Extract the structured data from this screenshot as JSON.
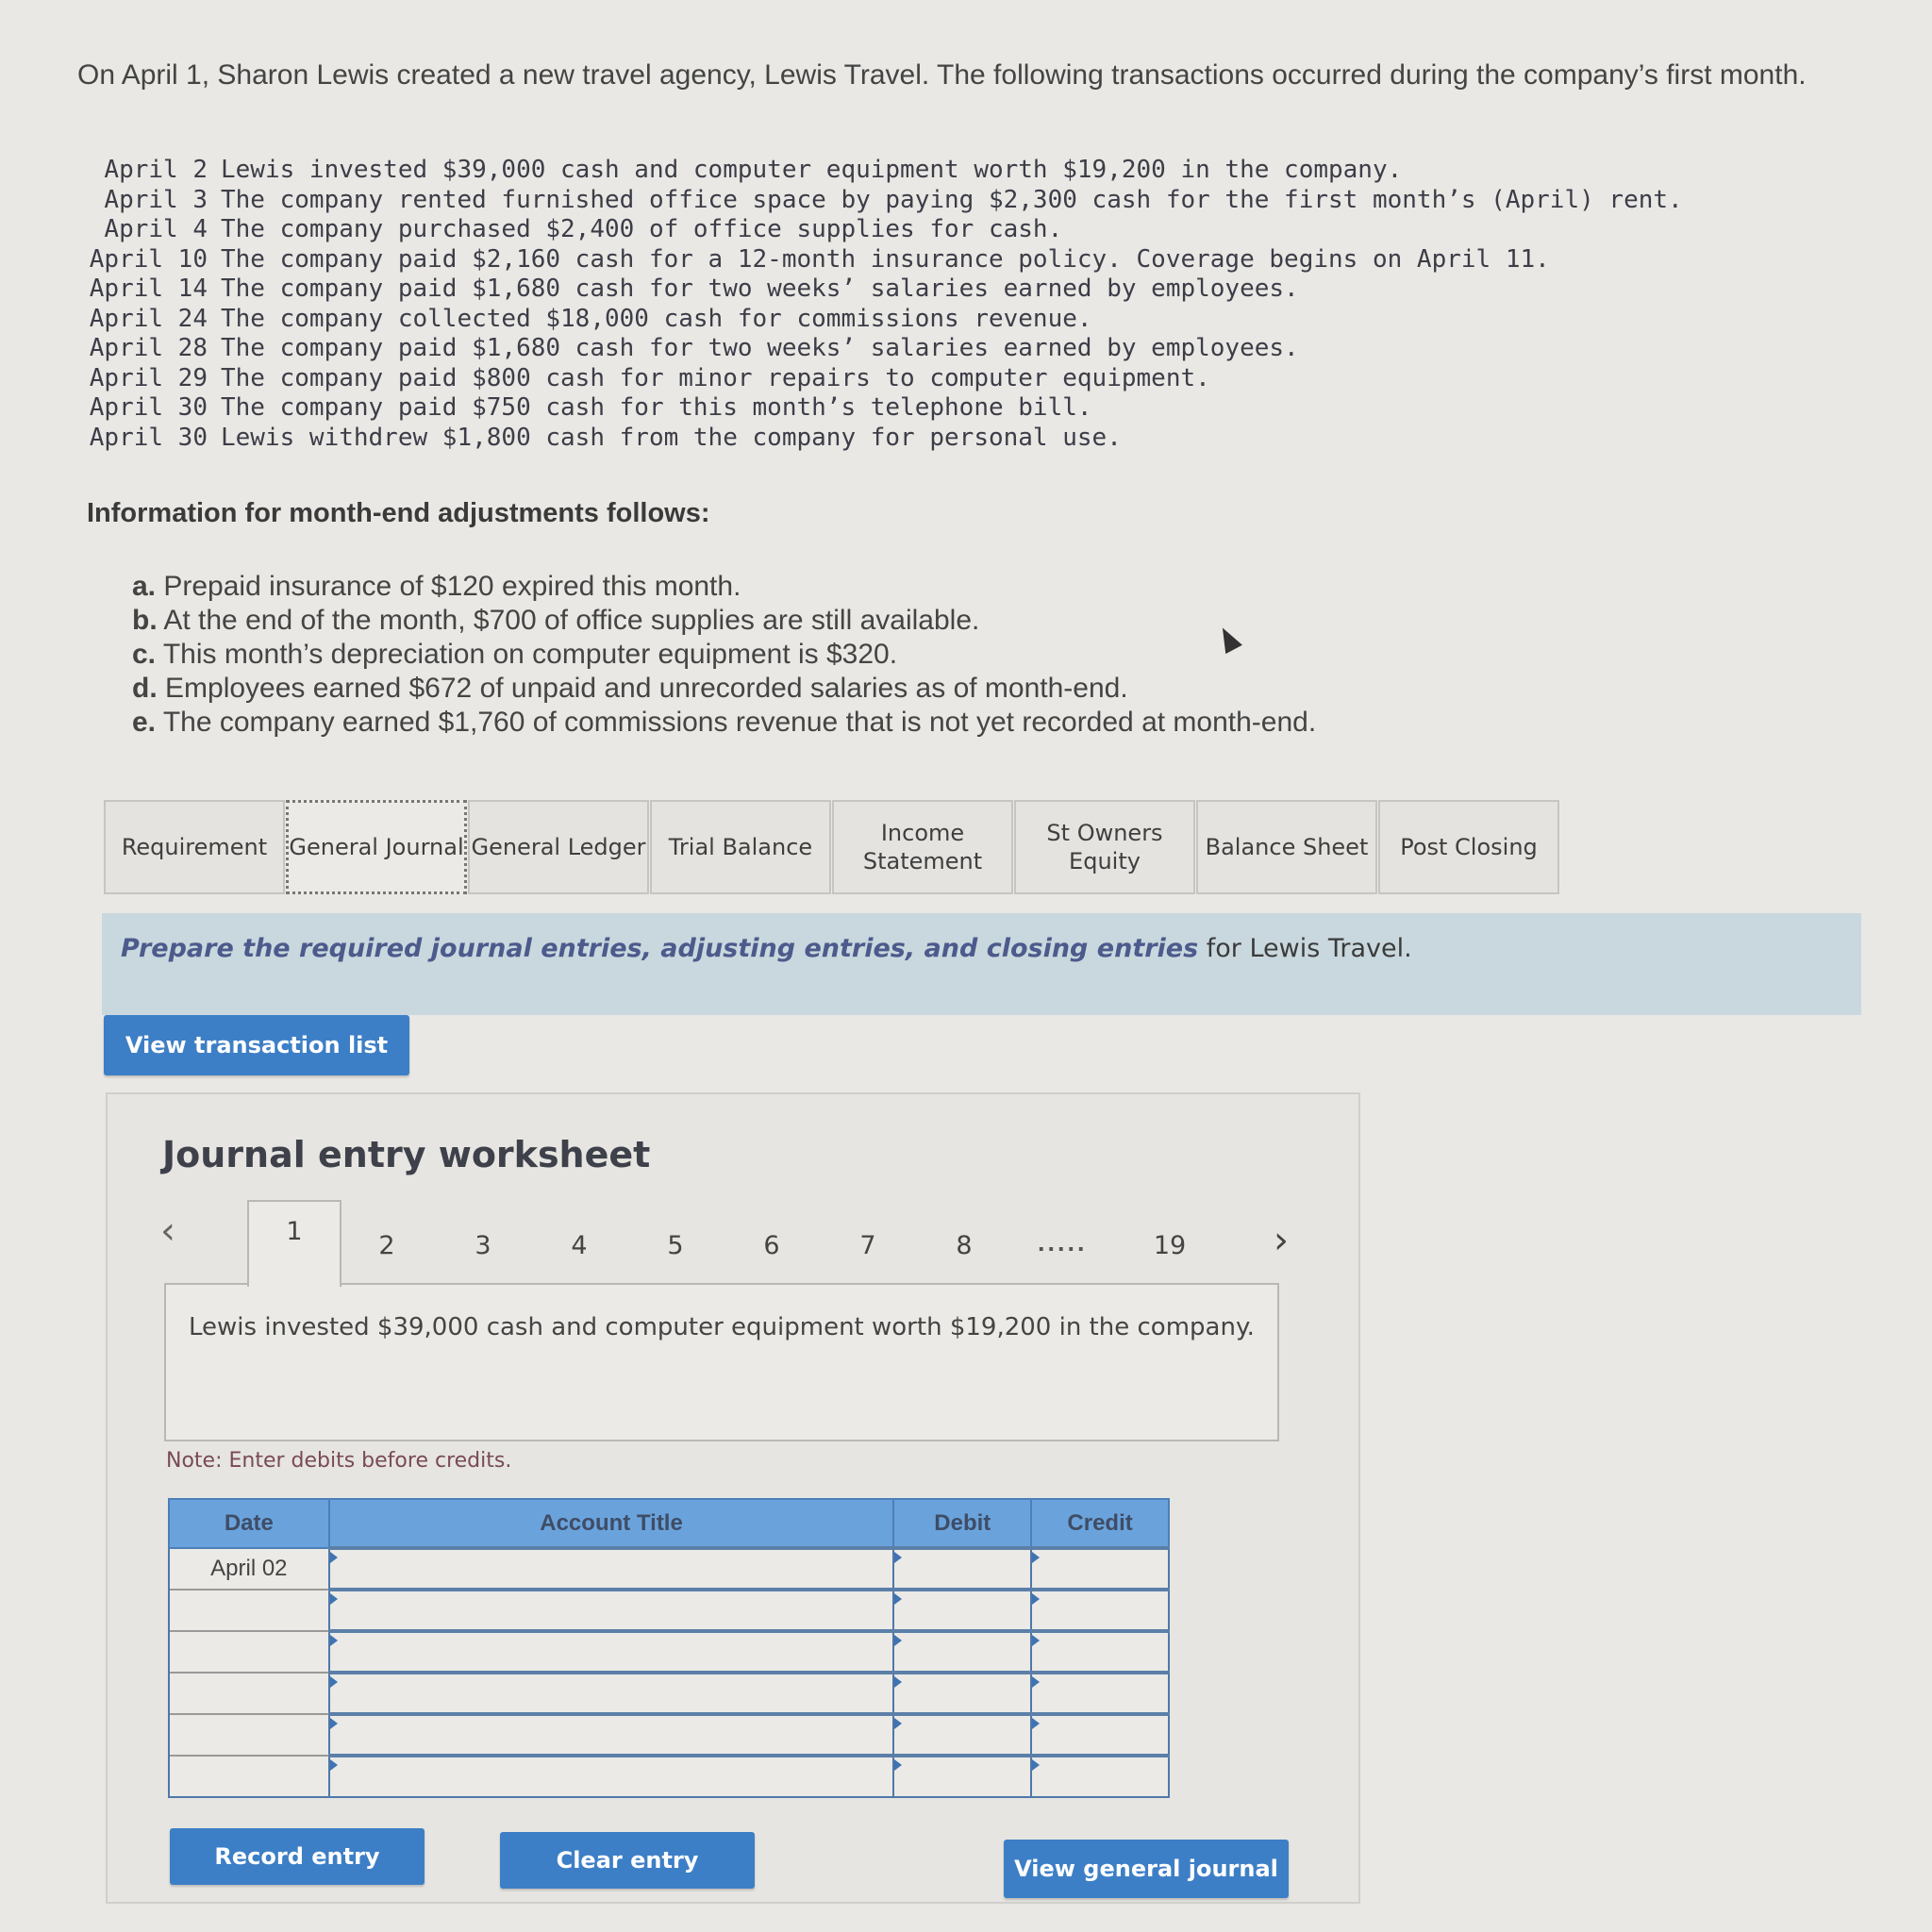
{
  "intro": "On April 1, Sharon Lewis created a new travel agency, Lewis Travel. The following transactions occurred during the company’s first month.",
  "transactions": [
    {
      "date": "April 2",
      "text": "Lewis invested $39,000 cash and computer equipment worth $19,200 in the company."
    },
    {
      "date": "April 3",
      "text": "The company rented furnished office space by paying $2,300 cash for the first month’s (April) rent."
    },
    {
      "date": "April 4",
      "text": "The company purchased $2,400 of office supplies for cash."
    },
    {
      "date": "April 10",
      "text": "The company paid $2,160 cash for a 12-month insurance policy. Coverage begins on April 11."
    },
    {
      "date": "April 14",
      "text": "The company paid $1,680 cash for two weeks’ salaries earned by employees."
    },
    {
      "date": "April 24",
      "text": "The company collected $18,000 cash for commissions revenue."
    },
    {
      "date": "April 28",
      "text": "The company paid $1,680 cash for two weeks’ salaries earned by employees."
    },
    {
      "date": "April 29",
      "text": "The company paid $800 cash for minor repairs to computer equipment."
    },
    {
      "date": "April 30",
      "text": "The company paid $750 cash for this month’s telephone bill."
    },
    {
      "date": "April 30",
      "text": "Lewis withdrew $1,800 cash from the company for personal use."
    }
  ],
  "adjustments": {
    "heading": "Information for month-end adjustments follows:",
    "items": [
      {
        "letter": "a.",
        "text": "Prepaid insurance of $120 expired this month."
      },
      {
        "letter": "b.",
        "text": "At the end of the month, $700 of office supplies are still available."
      },
      {
        "letter": "c.",
        "text": "This month’s depreciation on computer equipment is $320."
      },
      {
        "letter": "d.",
        "text": "Employees earned $672 of unpaid and unrecorded salaries as of month-end."
      },
      {
        "letter": "e.",
        "text": "The company earned $1,760 of commissions revenue that is not yet recorded at month-end."
      }
    ]
  },
  "tabs": [
    {
      "label": "Requirement",
      "active": false
    },
    {
      "label": "General Journal",
      "active": true
    },
    {
      "label": "General Ledger",
      "active": false
    },
    {
      "label": "Trial Balance",
      "active": false
    },
    {
      "label": "Income Statement",
      "active": false
    },
    {
      "label": "St Owners Equity",
      "active": false
    },
    {
      "label": "Balance Sheet",
      "active": false
    },
    {
      "label": "Post Closing",
      "active": false
    }
  ],
  "instruction": {
    "emphasis": "Prepare the required journal entries, adjusting entries, and closing entries",
    "rest": " for Lewis Travel."
  },
  "buttons": {
    "view_transaction_list": "View transaction list",
    "record_entry": "Record entry",
    "clear_entry": "Clear entry",
    "view_general_journal": "View general journal"
  },
  "worksheet": {
    "title": "Journal entry worksheet",
    "pages": [
      "1",
      "2",
      "3",
      "4",
      "5",
      "6",
      "7",
      "8",
      "19"
    ],
    "current_page": "1",
    "ellipsis": ".....",
    "description": "Lewis invested $39,000 cash and computer equipment worth $19,200 in the company.",
    "note": "Note: Enter debits before credits.",
    "columns": [
      "Date",
      "Account Title",
      "Debit",
      "Credit"
    ],
    "rows": [
      {
        "date": "April 02",
        "account": "",
        "debit": "",
        "credit": ""
      },
      {
        "date": "",
        "account": "",
        "debit": "",
        "credit": ""
      },
      {
        "date": "",
        "account": "",
        "debit": "",
        "credit": ""
      },
      {
        "date": "",
        "account": "",
        "debit": "",
        "credit": ""
      },
      {
        "date": "",
        "account": "",
        "debit": "",
        "credit": ""
      },
      {
        "date": "",
        "account": "",
        "debit": "",
        "credit": ""
      }
    ]
  }
}
